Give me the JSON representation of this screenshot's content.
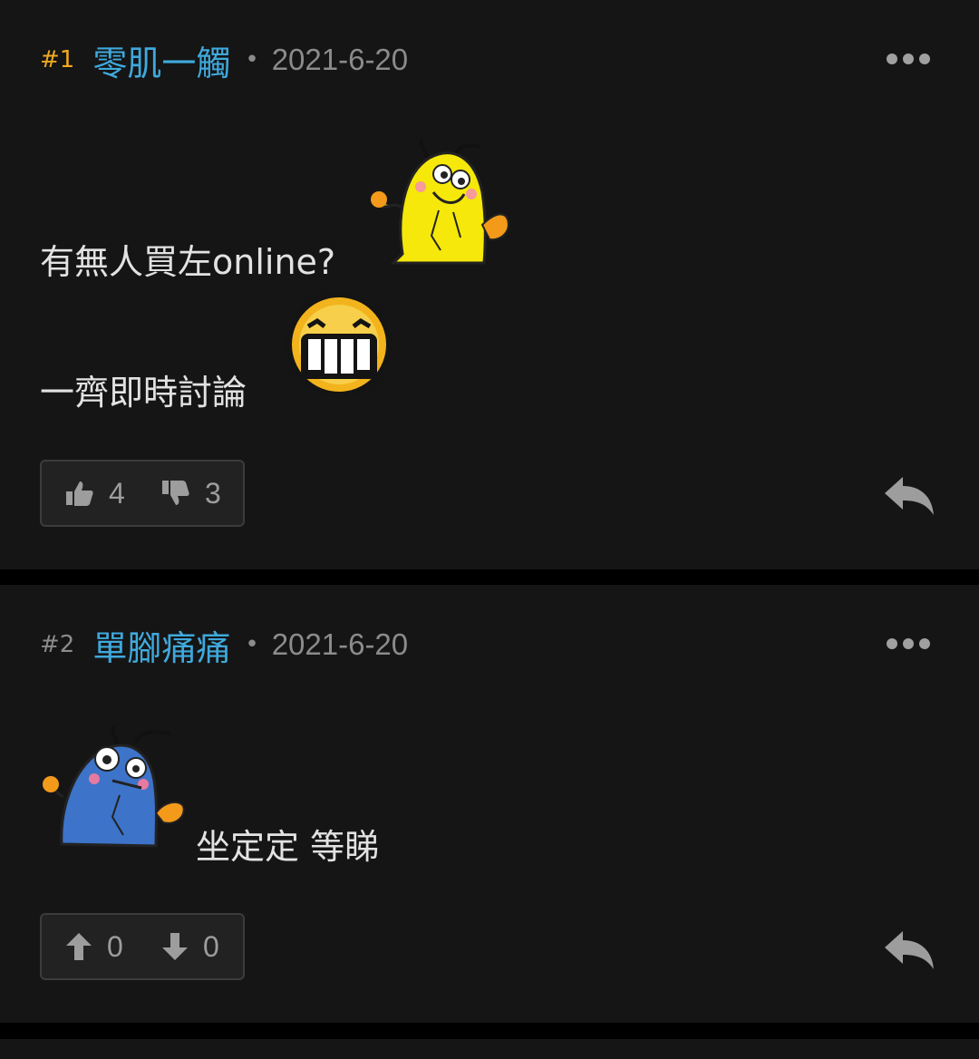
{
  "posts": [
    {
      "floor": "#1",
      "floor_color": "#f0a91e",
      "username": "零肌一觸",
      "date": "2021-6-20",
      "lines": [
        "有無人買左online?",
        "一齊即時討論"
      ],
      "vote_up_icon": "thumbs-up-icon",
      "vote_down_icon": "thumbs-down-icon",
      "likes": "4",
      "dislikes": "3"
    },
    {
      "floor": "#2",
      "floor_color": "#8b8b8b",
      "username": "單腳痛痛",
      "date": "2021-6-20",
      "lines": [
        "坐定定 等睇"
      ],
      "vote_up_icon": "arrow-up-icon",
      "vote_down_icon": "arrow-down-icon",
      "likes": "0",
      "dislikes": "0"
    }
  ],
  "separator": "•",
  "colors": {
    "username": "#3fa9dd",
    "background": "#151515",
    "muted": "#8b8b8b"
  }
}
